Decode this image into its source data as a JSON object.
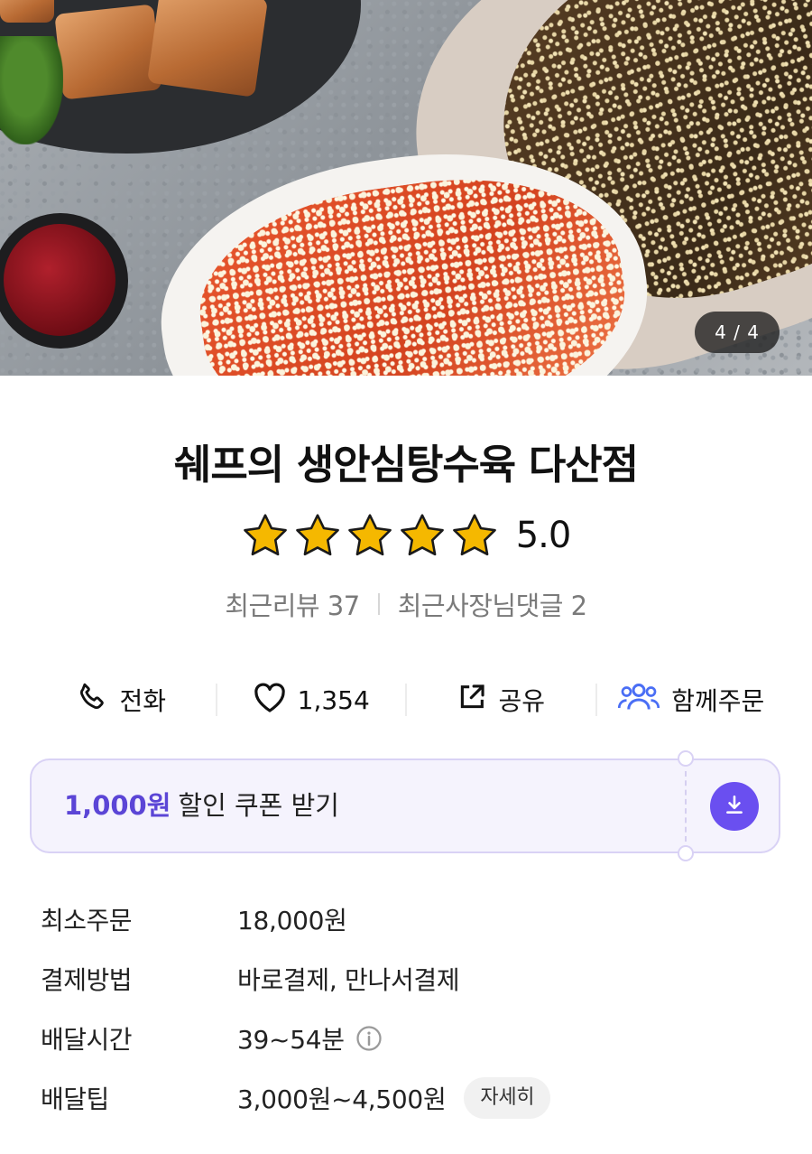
{
  "hero": {
    "counter": "4 / 4"
  },
  "store": {
    "name": "쉐프의 생안심탕수육 다산점",
    "rating": {
      "stars": 5,
      "value": "5.0"
    },
    "reviews_label": "최근리뷰 37",
    "owner_comments_label": "최근사장님댓글 2"
  },
  "actions": {
    "call": {
      "label": "전화",
      "icon": "phone-icon"
    },
    "like": {
      "label": "1,354",
      "icon": "heart-icon"
    },
    "share": {
      "label": "공유",
      "icon": "share-icon"
    },
    "group": {
      "label": "함께주문",
      "icon": "group-icon"
    }
  },
  "coupon": {
    "amount": "1,000원",
    "text": "할인 쿠폰 받기",
    "icon": "download-icon",
    "accent": "#6a4ff0"
  },
  "info": {
    "min_order": {
      "label": "최소주문",
      "value": "18,000원"
    },
    "payment": {
      "label": "결제방법",
      "value": "바로결제, 만나서결제"
    },
    "delivery_time": {
      "label": "배달시간",
      "value": "39~54분",
      "icon": "info-circle-icon"
    },
    "delivery_tip": {
      "label": "배달팁",
      "value": "3,000원~4,500원",
      "button": "자세히"
    }
  },
  "colors": {
    "star": "#f5b800",
    "coupon_text": "#5b45d6",
    "group_icon": "#4a6ef5"
  }
}
